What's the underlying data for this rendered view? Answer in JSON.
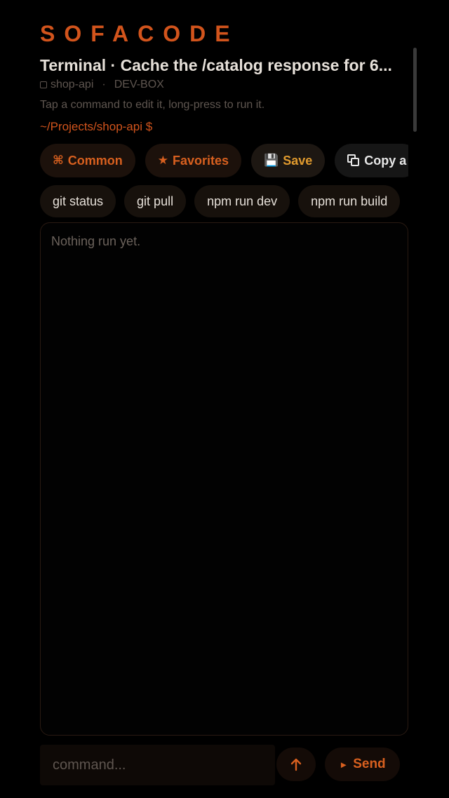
{
  "app": {
    "brand": "SOFACODE"
  },
  "header": {
    "title": "Terminal · Cache the /catalog response for 6...",
    "project": "shop-api",
    "separator": "·",
    "host": "DEV-BOX",
    "hint": "Tap a command to edit it, long-press to run it.",
    "cwd": "~/Projects/shop-api $"
  },
  "toolbar": {
    "common_icon": "⌘",
    "common_label": "Common",
    "favorites_icon": "★",
    "favorites_label": "Favorites",
    "save_icon": "💾",
    "save_label": "Save",
    "copy_label": "Copy a"
  },
  "quick_commands": [
    {
      "label": "git status"
    },
    {
      "label": "git pull"
    },
    {
      "label": "npm run dev"
    },
    {
      "label": "npm run build"
    }
  ],
  "output": {
    "empty_text": "Nothing run yet."
  },
  "composer": {
    "placeholder": "command...",
    "value": "",
    "history_icon": "arrow-up-icon",
    "send_icon": "►",
    "send_label": "Send"
  },
  "colors": {
    "accent": "#d2541c",
    "save_accent": "#e09a2e",
    "background": "#000000"
  }
}
